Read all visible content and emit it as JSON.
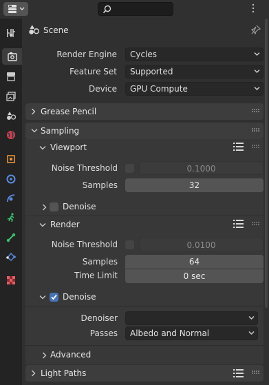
{
  "header": {
    "editor_type_icon": "properties-editor-icon",
    "search": {
      "placeholder": "",
      "value": ""
    }
  },
  "tabs": [
    {
      "name": "tool-icon",
      "active": false
    },
    {
      "name": "render-icon",
      "active": true
    },
    {
      "name": "output-icon",
      "active": false
    },
    {
      "name": "view-layer-icon",
      "active": false
    },
    {
      "name": "scene-icon",
      "active": false
    },
    {
      "name": "world-icon",
      "active": false
    },
    {
      "name": "object-icon",
      "active": false
    },
    {
      "name": "modifier-icon",
      "active": false
    },
    {
      "name": "particles-icon",
      "active": false
    },
    {
      "name": "physics-icon",
      "active": false
    },
    {
      "name": "constraints-icon",
      "active": false
    },
    {
      "name": "object-data-icon",
      "active": false
    },
    {
      "name": "texture-icon",
      "active": false
    }
  ],
  "context": {
    "label": "Scene"
  },
  "render": {
    "engine_label": "Render Engine",
    "engine_value": "Cycles",
    "feature_set_label": "Feature Set",
    "feature_set_value": "Supported",
    "device_label": "Device",
    "device_value": "GPU Compute"
  },
  "panels": {
    "grease_pencil": "Grease Pencil",
    "sampling": "Sampling",
    "viewport": "Viewport",
    "render_sub": "Render",
    "advanced": "Advanced",
    "light_paths": "Light Paths"
  },
  "viewport": {
    "noise_threshold_label": "Noise Threshold",
    "noise_threshold_value": "0.1000",
    "noise_threshold_enabled": false,
    "samples_label": "Samples",
    "samples_value": "32",
    "denoise_label": "Denoise",
    "denoise_enabled": false
  },
  "render_settings": {
    "noise_threshold_label": "Noise Threshold",
    "noise_threshold_value": "0.0100",
    "noise_threshold_enabled": false,
    "samples_label": "Samples",
    "samples_value": "64",
    "time_limit_label": "Time Limit",
    "time_limit_value": "0 sec",
    "denoise_label": "Denoise",
    "denoise_enabled": true,
    "denoiser_label": "Denoiser",
    "denoiser_value": "",
    "passes_label": "Passes",
    "passes_value": "Albedo and Normal"
  },
  "colors": {
    "background": "#303030",
    "panel": "#3d3d3d",
    "accent": "#4772b3"
  }
}
